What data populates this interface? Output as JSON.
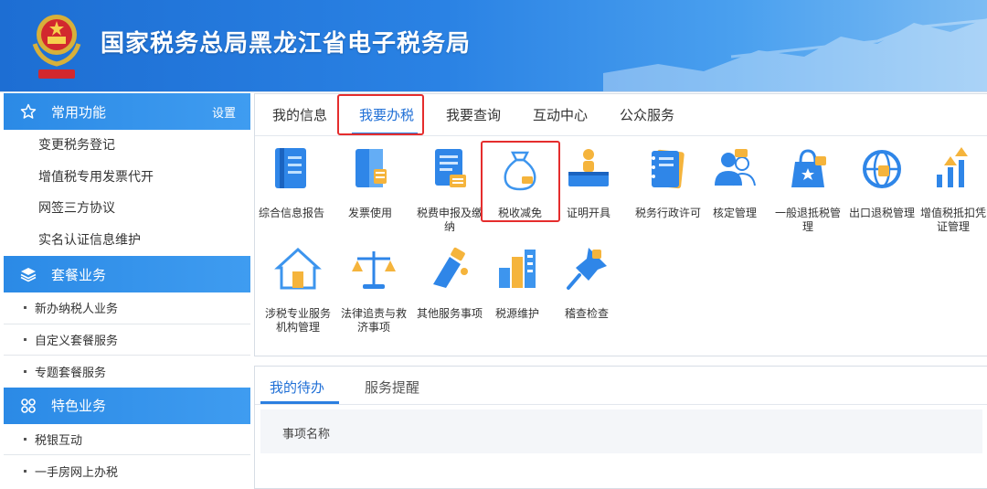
{
  "header": {
    "title": "国家税务总局黑龙江省电子税务局",
    "emblem_icon": "national-emblem-icon",
    "colors": {
      "start": "#1d6ed3",
      "end": "#7dbcf3"
    }
  },
  "sidebar": {
    "sections": [
      {
        "icon": "star-icon",
        "title": "常用功能",
        "setting": "设置",
        "items": [
          "变更税务登记",
          "增值税专用发票代开",
          "网签三方协议",
          "实名认证信息维护"
        ]
      },
      {
        "icon": "layers-icon",
        "title": "套餐业务",
        "items": [
          "新办纳税人业务",
          "自定义套餐服务",
          "专题套餐服务"
        ]
      },
      {
        "icon": "grid-icon",
        "title": "特色业务",
        "items": [
          "税银互动",
          "一手房网上办税"
        ]
      }
    ]
  },
  "main": {
    "tabs": [
      "我的信息",
      "我要办税",
      "我要查询",
      "互动中心",
      "公众服务"
    ],
    "active_tab": "我要办税",
    "tiles": [
      {
        "label": "综合信息报告",
        "icon": "document-report-icon"
      },
      {
        "label": "发票使用",
        "icon": "invoice-icon"
      },
      {
        "label": "税费申报及缴纳",
        "icon": "tax-declaration-icon"
      },
      {
        "label": "税收减免",
        "icon": "money-bag-icon"
      },
      {
        "label": "证明开具",
        "icon": "certificate-person-icon"
      },
      {
        "label": "税务行政许可",
        "icon": "permit-notebook-icon"
      },
      {
        "label": "核定管理",
        "icon": "users-icon"
      },
      {
        "label": "一般退抵税管理",
        "icon": "refund-bag-icon"
      },
      {
        "label": "出口退税管理",
        "icon": "globe-icon"
      },
      {
        "label": "增值税抵扣凭证管理",
        "icon": "bar-growth-icon"
      },
      {
        "label": "涉税专业服务机构管理",
        "icon": "house-tools-icon"
      },
      {
        "label": "法律追责与救济事项",
        "icon": "scales-icon"
      },
      {
        "label": "其他服务事项",
        "icon": "hand-service-icon"
      },
      {
        "label": "税源维护",
        "icon": "buildings-icon"
      },
      {
        "label": "稽查检查",
        "icon": "pushpin-icon"
      }
    ]
  },
  "bottom": {
    "tabs": [
      "我的待办",
      "服务提醒"
    ],
    "active_tab": "我的待办",
    "column_header": "事项名称"
  }
}
